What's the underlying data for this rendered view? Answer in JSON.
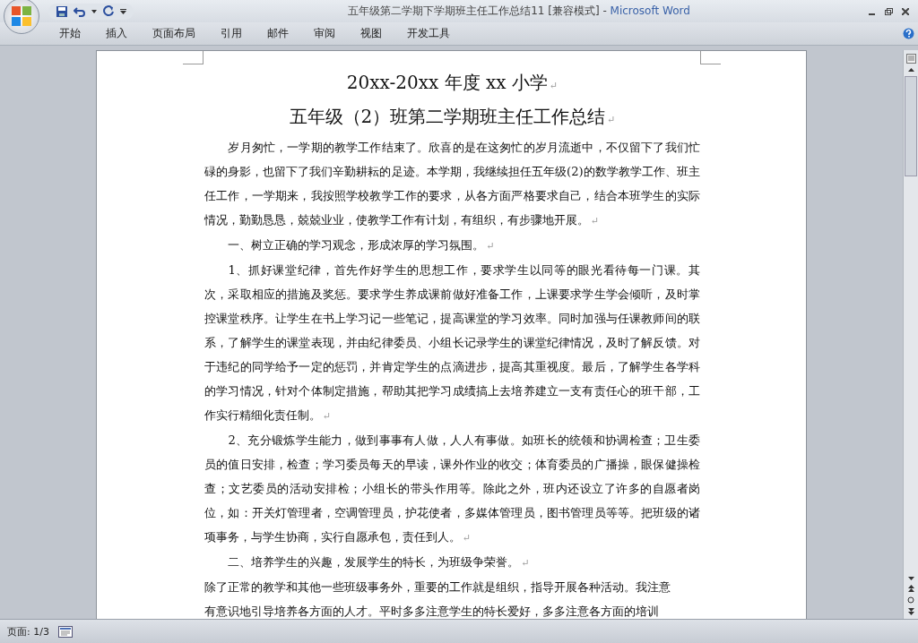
{
  "window": {
    "title": "五年级第二学期下学期班主任工作总结11 [兼容模式]",
    "separator": "-",
    "app_name": "Microsoft Word"
  },
  "tabs": [
    {
      "label": "开始",
      "selected": false
    },
    {
      "label": "插入",
      "selected": false
    },
    {
      "label": "页面布局",
      "selected": false
    },
    {
      "label": "引用",
      "selected": false
    },
    {
      "label": "邮件",
      "selected": false
    },
    {
      "label": "审阅",
      "selected": false
    },
    {
      "label": "视图",
      "selected": false
    },
    {
      "label": "开发工具",
      "selected": false
    }
  ],
  "document": {
    "titles": [
      {
        "text": "20xx-20xx 年度 xx 小学",
        "mark": "↵"
      },
      {
        "text": "五年级（2）班第二学期班主任工作总结",
        "mark": "↵"
      }
    ],
    "paragraphs": [
      {
        "text": "岁月匆忙，一学期的教学工作结束了。欣喜的是在这匆忙的岁月流逝中，不仅留下了我们忙碌的身影，也留下了我们辛勤耕耘的足迹。本学期，我继续担任五年级(2)的数学教学工作、班主任工作，一学期来，我按照学校教学工作的要求，从各方面严格要求自己，结合本班学生的实际情况，勤勤恳恳，兢兢业业，使教学工作有计划，有组织，有步骤地开展。",
        "indent": true,
        "mark": "↵"
      },
      {
        "text": "一、树立正确的学习观念，形成浓厚的学习氛围。",
        "indent": true,
        "mark": "↵"
      },
      {
        "text": "1、抓好课堂纪律，首先作好学生的思想工作，要求学生以同等的眼光看待每一门课。其次，采取相应的措施及奖惩。要求学生养成课前做好准备工作，上课要求学生学会倾听，及时掌控课堂秩序。让学生在书上学习记一些笔记，提高课堂的学习效率。同时加强与任课教师间的联系，了解学生的课堂表现，并由纪律委员、小组长记录学生的课堂纪律情况，及时了解反馈。对于违纪的同学给予一定的惩罚，并肯定学生的点滴进步，提高其重视度。最后，了解学生各学科的学习情况，针对个体制定措施，帮助其把学习成绩搞上去培养建立一支有责任心的班干部，工作实行精细化责任制。",
        "indent": true,
        "mark": "↵"
      },
      {
        "text": "2、充分锻炼学生能力，做到事事有人做，人人有事做。如班长的统领和协调检查；卫生委员的值日安排，检查；学习委员每天的早读，课外作业的收交；体育委员的广播操，眼保健操检查；文艺委员的活动安排检；小组长的带头作用等。除此之外，班内还设立了许多的自愿者岗位，如：开关灯管理者，空调管理员，护花使者，多媒体管理员，图书管理员等等。把班级的诸项事务，与学生协商，实行自愿承包，责任到人。",
        "indent": true,
        "mark": "↵"
      },
      {
        "text": "二、培养学生的兴趣，发展学生的特长，为班级争荣誉。",
        "indent": true,
        "mark": "↵"
      },
      {
        "text": "除了正常的教学和其他一些班级事务外，重要的工作就是组织，指导开展各种活动。我注意",
        "indent": false
      },
      {
        "text": "有意识地引导培养各方面的人才。平时多多注意学生的特长爱好，多多注意各方面的培训",
        "indent": false
      }
    ]
  },
  "status_bar": {
    "page": "页面: 1/3"
  }
}
